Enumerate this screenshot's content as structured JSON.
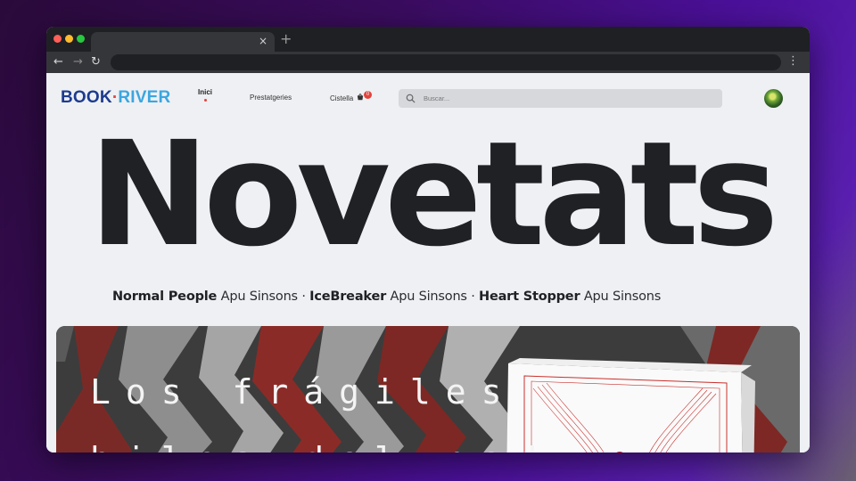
{
  "browser": {
    "tab_close": "×",
    "new_tab": "+",
    "back": "←",
    "forward": "→",
    "reload": "↻",
    "menu": "⋮"
  },
  "header": {
    "logo": {
      "part1": "BOOK",
      "sep": "·",
      "part2": "RIVER"
    },
    "nav": [
      {
        "label": "Inici",
        "active": true
      },
      {
        "label": "Prestatgeries",
        "active": false
      },
      {
        "label": "Cistella",
        "active": false
      }
    ],
    "cart_count": "0",
    "search": {
      "placeholder": "Buscar..."
    }
  },
  "hero": {
    "title": "Novetats",
    "featured": [
      {
        "title": "Normal People",
        "author": "Apu Sinsons"
      },
      {
        "title": "IceBreaker",
        "author": "Apu Sinsons"
      },
      {
        "title": "Heart Stopper",
        "author": "Apu Sinsons"
      }
    ],
    "separator": " · "
  },
  "banner": {
    "line1": "Los frágiles",
    "line2": "hilos del poder"
  },
  "colors": {
    "accent": "#e3433d",
    "logo_blue": "#1d3b8f",
    "logo_cyan": "#3aa6e0",
    "page_bg": "#eef0f3",
    "text_dark": "#202124"
  }
}
